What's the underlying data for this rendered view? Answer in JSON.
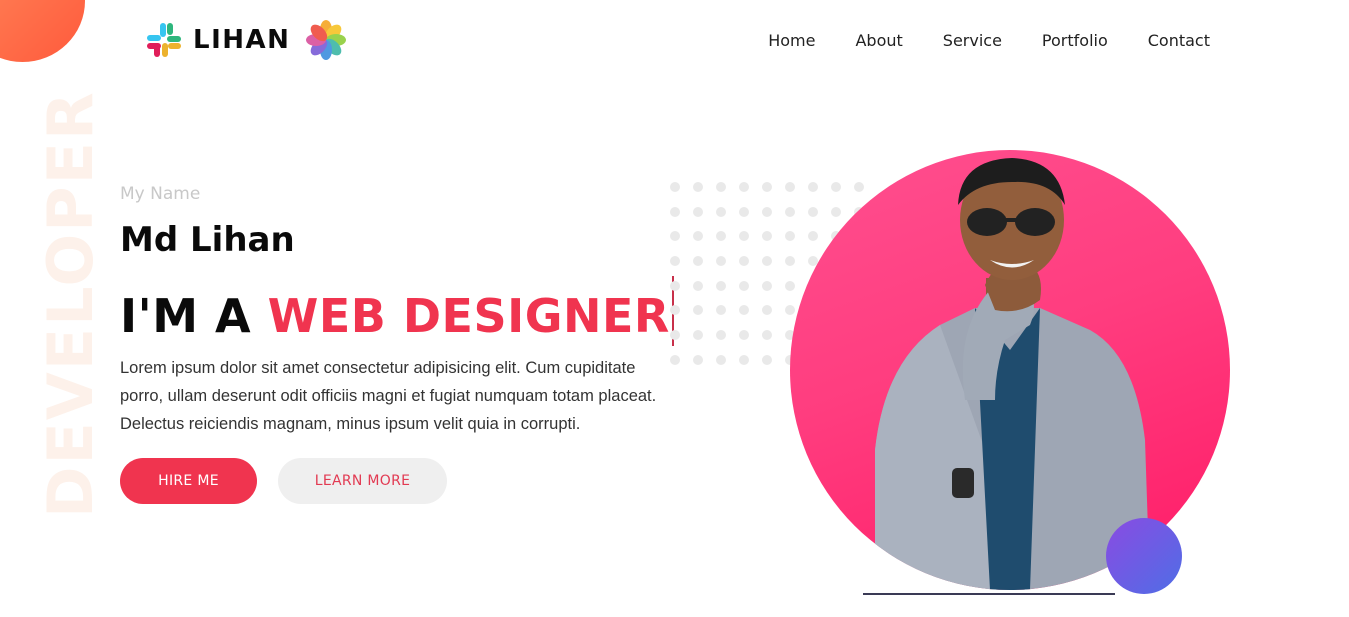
{
  "brand": {
    "name": "LIHAN",
    "logo_icon": "slack-style-logo-icon",
    "flower_icon": "photos-flower-icon"
  },
  "nav": {
    "items": [
      "Home",
      "About",
      "Service",
      "Portfolio",
      "Contact"
    ]
  },
  "watermark": "DEVELOPER",
  "hero": {
    "label": "My Name",
    "name": "Md Lihan",
    "headline_prefix": "I'M A ",
    "headline_accent": "WEB DESIGNER",
    "description": "Lorem ipsum dolor sit amet consectetur adipisicing elit. Cum cupiditate porro, ullam deserunt odit officiis magni et fugiat numquam totam placeat. Delectus reiciendis magnam, minus ipsum velit quia in corrupti.",
    "hire_button": "HIRE ME",
    "learn_button": "LEARN MORE"
  },
  "colors": {
    "accent": "#f0344f",
    "circle": "#ff3d7f",
    "ball": "#6a5ae6",
    "corner": "#ff6b4a"
  }
}
